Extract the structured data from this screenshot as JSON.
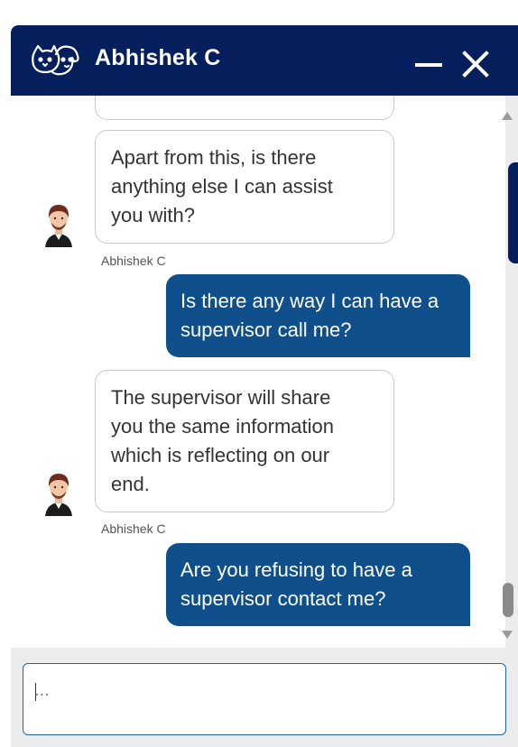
{
  "header": {
    "agent_name": "Abhishek C",
    "brand_icon": "dog-cat-icon",
    "minimize_icon": "minimize-icon",
    "close_icon": "close-icon",
    "background_color": "#041f5c"
  },
  "messages": [
    {
      "type": "agent",
      "lines": [
        "Apart from this, is there",
        "anything else I can assist",
        "you with?"
      ],
      "sender": "Abhishek C"
    },
    {
      "type": "user",
      "lines": [
        "Is there any way I can have a",
        "supervisor call me?"
      ]
    },
    {
      "type": "agent",
      "lines": [
        "The supervisor will share",
        "you the same information",
        "which is reflecting on our",
        "end."
      ],
      "sender": "Abhishek C"
    },
    {
      "type": "user",
      "lines": [
        "Are you refusing to have a",
        "supervisor contact me?"
      ]
    }
  ],
  "composer": {
    "placeholder": "..."
  },
  "colors": {
    "user_bubble": "#0f4f8c",
    "agent_bubble_border": "#c9c9c9",
    "input_border": "#1b66b3"
  }
}
